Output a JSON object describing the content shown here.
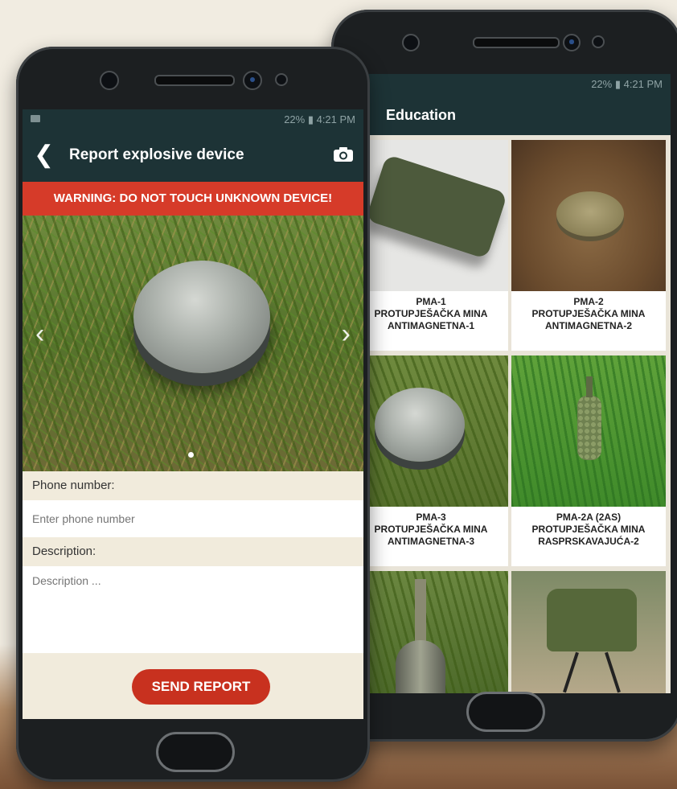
{
  "colors": {
    "appbar": "#1d3336",
    "warning": "#d63b29",
    "send_button": "#c8311f",
    "field_background": "#f1ebdc"
  },
  "back_phone": {
    "status_text": "22% ▮ 4:21 PM",
    "title": "Education",
    "tiles": [
      {
        "lines": [
          "PMA-1",
          "PROTUPJEŠAČKA MINA",
          "ANTIMAGNETNA-1"
        ]
      },
      {
        "lines": [
          "PMA-2",
          "PROTUPJEŠAČKA MINA",
          "ANTIMAGNETNA-2"
        ]
      },
      {
        "lines": [
          "PMA-3",
          "PROTUPJEŠAČKA MINA",
          "ANTIMAGNETNA-3"
        ]
      },
      {
        "lines": [
          "PMA-2A (2AS)",
          "PROTUPJEŠAČKA MINA",
          "RASPRSKAVAJUĆA-2"
        ]
      },
      {
        "lines": []
      },
      {
        "lines": []
      }
    ]
  },
  "front_phone": {
    "status_text": "22% ▮ 4:21 PM",
    "title": "Report explosive device",
    "icons": {
      "back": "back-chevron-icon",
      "camera": "camera-icon",
      "prev": "chevron-left-icon",
      "next": "chevron-right-icon"
    },
    "warning": "WARNING: DO NOT TOUCH UNKNOWN DEVICE!",
    "phone_label": "Phone number:",
    "phone_placeholder": "Enter phone number",
    "description_label": "Description:",
    "description_placeholder": "Description ...",
    "send_label": "SEND REPORT"
  }
}
